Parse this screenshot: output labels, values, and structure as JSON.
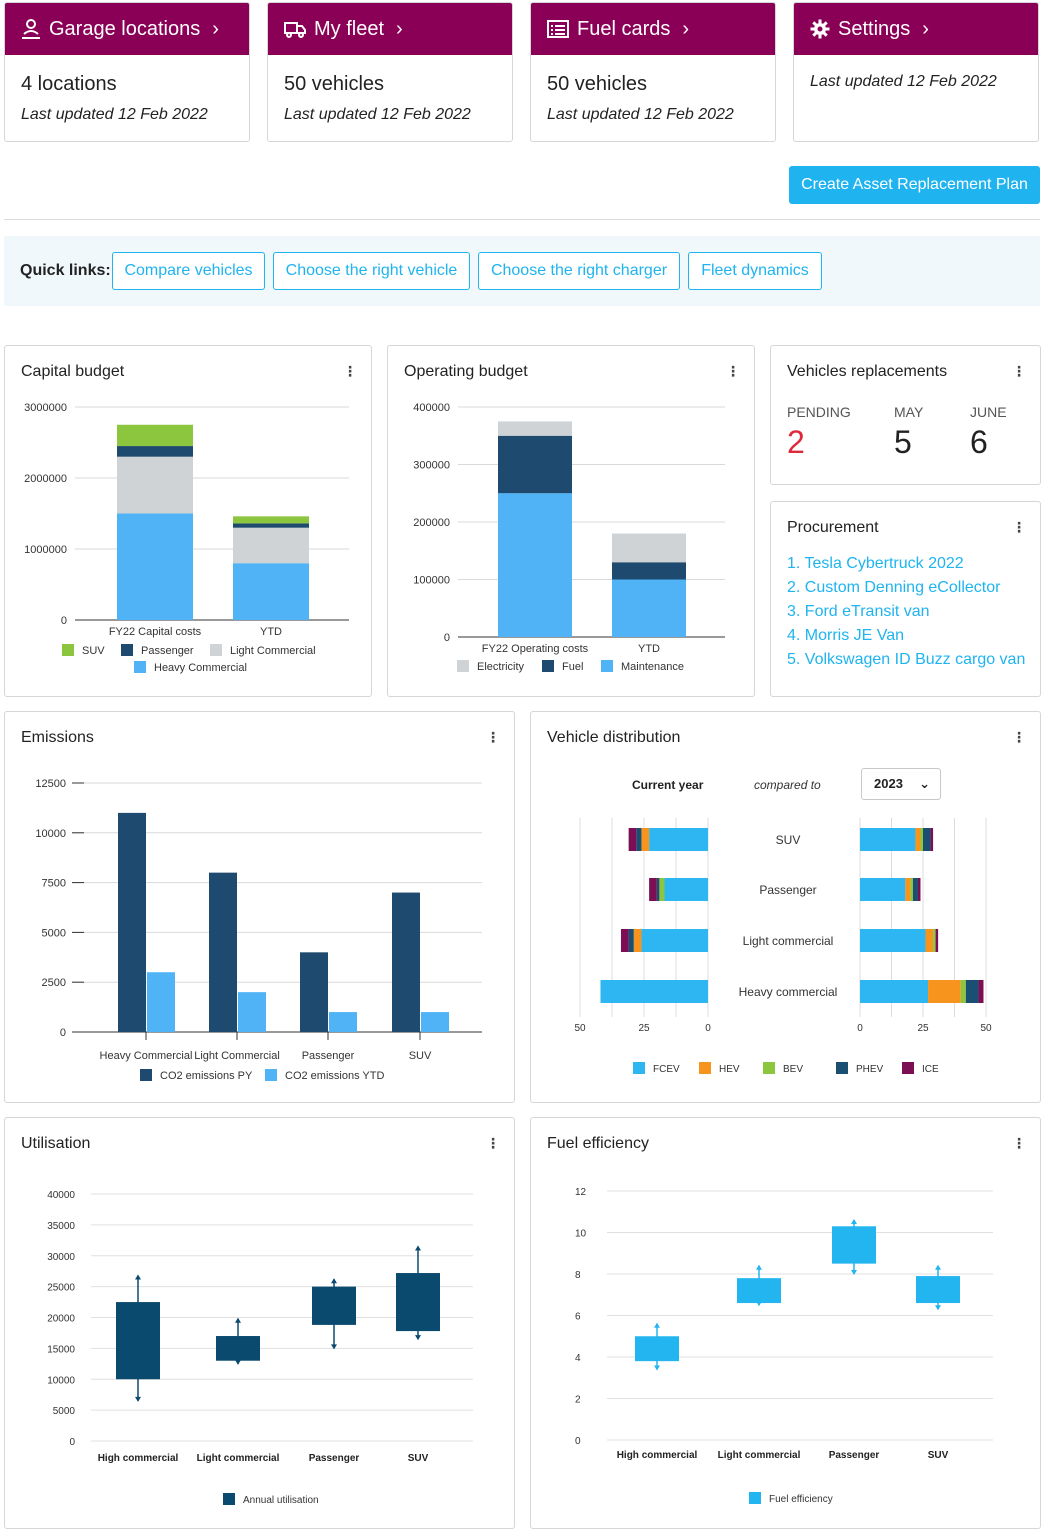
{
  "nav_cards": [
    {
      "title": "Garage locations",
      "icon": "location-user-icon",
      "value": "4 locations",
      "updated": "Last updated 12 Feb 2022"
    },
    {
      "title": "My fleet",
      "icon": "truck-icon",
      "value": "50 vehicles",
      "updated": "Last updated 12 Feb 2022"
    },
    {
      "title": "Fuel cards",
      "icon": "list-card-icon",
      "value": "50 vehicles",
      "updated": "Last updated 12 Feb 2022"
    },
    {
      "title": "Settings",
      "icon": "gear-icon",
      "value": "",
      "updated": "Last updated 12 Feb 2022"
    }
  ],
  "create_button": "Create Asset Replacement Plan",
  "quick_links": {
    "label": "Quick links:",
    "links": [
      "Compare vehicles",
      "Choose the right vehicle",
      "Choose the right charger",
      "Fleet dynamics"
    ]
  },
  "menu_icon": "more-vertical-icon",
  "colors": {
    "brand": "#8b0057",
    "accent": "#1fb4ef",
    "suv": "#8cc63f",
    "passenger": "#1d4a6e",
    "light_commercial": "#d0d3d6",
    "heavy_commercial": "#4fb3f6",
    "pending": "#e0283c",
    "fcev": "#2eb6f2",
    "hev": "#f7941d",
    "bev": "#8cc63f",
    "phev": "#1b4f72",
    "ice": "#7b0e55",
    "utilisation": "#0b4a6f",
    "fuel_eff": "#23b5ef"
  },
  "capital_budget": {
    "title": "Capital budget",
    "chart_data": {
      "type": "bar",
      "stacked": true,
      "categories": [
        "FY22 Capital costs",
        "YTD"
      ],
      "series": [
        {
          "name": "Heavy Commercial",
          "values": [
            1500000,
            800000
          ]
        },
        {
          "name": "Light Commercial",
          "values": [
            800000,
            500000
          ]
        },
        {
          "name": "Passenger",
          "values": [
            150000,
            60000
          ]
        },
        {
          "name": "SUV",
          "values": [
            300000,
            100000
          ]
        }
      ],
      "ylim": [
        0,
        3000000
      ],
      "yticks": [
        "3000000",
        "2000000",
        "1000000",
        "0"
      ],
      "legend": [
        "SUV",
        "Passenger",
        "Light Commercial",
        "Heavy Commercial"
      ],
      "legend_position": "bottom",
      "grid": true
    }
  },
  "operating_budget": {
    "title": "Operating budget",
    "chart_data": {
      "type": "bar",
      "stacked": true,
      "categories": [
        "FY22 Operating costs",
        "YTD"
      ],
      "series": [
        {
          "name": "Maintenance",
          "values": [
            250000,
            100000
          ]
        },
        {
          "name": "Fuel",
          "values": [
            100000,
            30000
          ]
        },
        {
          "name": "Electricity",
          "values": [
            25000,
            50000
          ]
        }
      ],
      "ylim": [
        0,
        400000
      ],
      "yticks": [
        "400000",
        "300000",
        "200000",
        "100000",
        "0"
      ],
      "legend": [
        "Electricity",
        "Fuel",
        "Maintenance"
      ],
      "legend_position": "bottom",
      "grid": true
    }
  },
  "vehicle_replacements": {
    "title": "Vehicles replacements",
    "items": [
      {
        "label": "PENDING",
        "value": "2"
      },
      {
        "label": "MAY",
        "value": "5"
      },
      {
        "label": "JUNE",
        "value": "6"
      }
    ]
  },
  "procurement": {
    "title": "Procurement",
    "items": [
      "1. Tesla Cybertruck 2022",
      "2. Custom Denning eCollector",
      "3. Ford eTransit van",
      "4. Morris JE Van",
      "5. Volkswagen ID Buzz cargo van"
    ]
  },
  "emissions": {
    "title": "Emissions",
    "chart_data": {
      "type": "bar",
      "categories": [
        "Heavy Commercial",
        "Light Commercial",
        "Passenger",
        "SUV"
      ],
      "series": [
        {
          "name": "CO2 emissions PY",
          "values": [
            11000,
            8000,
            4000,
            7000
          ]
        },
        {
          "name": "CO2 emissions YTD",
          "values": [
            3000,
            2000,
            1000,
            1000
          ]
        }
      ],
      "ylim": [
        0,
        12500
      ],
      "yticks": [
        "12500",
        "10000",
        "7500",
        "5000",
        "2500",
        "0"
      ],
      "legend_position": "bottom",
      "grid": true
    }
  },
  "vehicle_distribution": {
    "title": "Vehicle distribution",
    "current_label": "Current year",
    "compared_label": "compared to",
    "selected_year": "2023",
    "chart_data": {
      "type": "bar",
      "orientation": "horizontal",
      "stacked": true,
      "categories": [
        "SUV",
        "Passenger",
        "Light commercial",
        "Heavy commercial"
      ],
      "legend": [
        "FCEV",
        "HEV",
        "BEV",
        "PHEV",
        "ICE"
      ],
      "current_year": {
        "series": [
          {
            "name": "FCEV",
            "values": [
              23,
              17,
              26,
              42
            ]
          },
          {
            "name": "HEV",
            "values": [
              3,
              0,
              3,
              0
            ]
          },
          {
            "name": "BEV",
            "values": [
              0,
              2,
              0,
              0
            ]
          },
          {
            "name": "PHEV",
            "values": [
              2,
              1,
              2,
              0
            ]
          },
          {
            "name": "ICE",
            "values": [
              3,
              3,
              3,
              0
            ]
          }
        ]
      },
      "compared_year": {
        "series": [
          {
            "name": "FCEV",
            "values": [
              22,
              18,
              26,
              27
            ]
          },
          {
            "name": "HEV",
            "values": [
              2,
              2,
              3,
              13
            ]
          },
          {
            "name": "BEV",
            "values": [
              1,
              1,
              1,
              2
            ]
          },
          {
            "name": "PHEV",
            "values": [
              3,
              2,
              0,
              5
            ]
          },
          {
            "name": "ICE",
            "values": [
              1,
              1,
              1,
              2
            ]
          }
        ]
      },
      "xticks_left": [
        "50",
        "25",
        "0"
      ],
      "xticks_right": [
        "0",
        "25",
        "50"
      ],
      "xlim": [
        0,
        50
      ],
      "legend_position": "bottom"
    }
  },
  "utilisation": {
    "title": "Utilisation",
    "chart_data": {
      "type": "box",
      "categories": [
        "High commercial",
        "Light commercial",
        "Passenger",
        "SUV"
      ],
      "series": [
        {
          "name": "Annual utilisation",
          "boxes": [
            {
              "min": 6500,
              "q1": 10000,
              "q3": 22500,
              "max": 26800
            },
            {
              "min": 12500,
              "q1": 13000,
              "q3": 17000,
              "max": 19800
            },
            {
              "min": 15000,
              "q1": 18800,
              "q3": 25000,
              "max": 26200
            },
            {
              "min": 16500,
              "q1": 17800,
              "q3": 27200,
              "max": 31500
            }
          ]
        }
      ],
      "ylim": [
        0,
        40000
      ],
      "yticks": [
        "40000",
        "35000",
        "30000",
        "25000",
        "20000",
        "15000",
        "10000",
        "5000",
        "0"
      ],
      "legend_position": "bottom",
      "grid": true
    }
  },
  "fuel_efficiency": {
    "title": "Fuel efficiency",
    "chart_data": {
      "type": "box",
      "categories": [
        "High commercial",
        "Light commercial",
        "Passenger",
        "SUV"
      ],
      "series": [
        {
          "name": "Fuel efficiency",
          "boxes": [
            {
              "min": 3.4,
              "q1": 3.8,
              "q3": 5.0,
              "max": 5.6
            },
            {
              "min": 6.5,
              "q1": 6.6,
              "q3": 7.8,
              "max": 8.4
            },
            {
              "min": 8.0,
              "q1": 8.5,
              "q3": 10.3,
              "max": 10.6
            },
            {
              "min": 6.3,
              "q1": 6.6,
              "q3": 7.9,
              "max": 8.4
            }
          ]
        }
      ],
      "ylim": [
        0,
        12
      ],
      "yticks": [
        "12",
        "10",
        "8",
        "6",
        "4",
        "2",
        "0"
      ],
      "legend_position": "bottom",
      "grid": true
    }
  }
}
